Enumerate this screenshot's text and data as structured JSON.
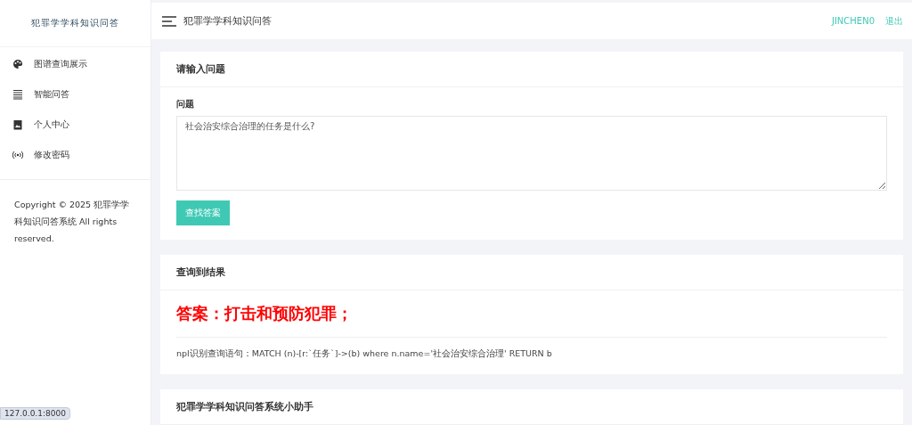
{
  "sidebar": {
    "logo": "犯罪学学科知识问答",
    "items": [
      {
        "label": "图谱查询展示",
        "selected": false
      },
      {
        "label": "智能问答",
        "selected": false
      },
      {
        "label": "个人中心",
        "selected": false
      },
      {
        "label": "修改密码",
        "selected": false
      }
    ],
    "copyright": "Copyright © 2025 犯罪学学科知识问答系统 All rights reserved."
  },
  "header": {
    "title": "犯罪学学科知识问答",
    "user": "JINCHEN0",
    "logout": "退出"
  },
  "question_card": {
    "title": "请输入问题",
    "label": "问题",
    "value": "社会治安综合治理的任务是什么?",
    "button": "查找答案"
  },
  "result_card": {
    "title": "查询到结果",
    "answer": "答案：打击和预防犯罪；",
    "query": "npl识别查询语句：MATCH (n)-[r:`任务`]->(b) where n.name='社会治安综合治理' RETURN b"
  },
  "assistant_card": {
    "title": "犯罪学学科知识问答系统小助手"
  },
  "status_url": "127.0.0.1:8000"
}
